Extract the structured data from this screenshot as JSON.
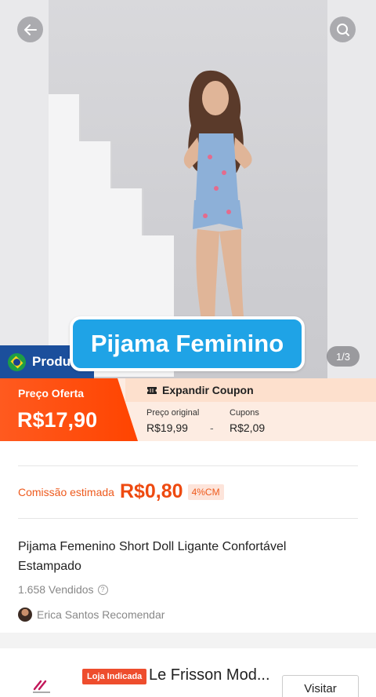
{
  "hero": {
    "image_counter": "1/3",
    "origin_tag": "Produ",
    "title_overlay": "Pijama Feminino"
  },
  "price": {
    "offer_label": "Preço Oferta",
    "offer_value": "R$17,90",
    "coupon_title": "Expandir Coupon",
    "original_label": "Preço original",
    "original_value": "R$19,99",
    "minus": "-",
    "coupons_label": "Cupons",
    "coupons_value": "R$2,09"
  },
  "commission": {
    "label": "Comissão estimada",
    "value": "R$0,80",
    "rate": "4%CM"
  },
  "product": {
    "title": "Pijama Femenino Short Doll Ligante Confortável Estampado",
    "sold": "1.658 Vendidos",
    "recommender": "Erica Santos Recomendar"
  },
  "store": {
    "badge": "Loja Indicada",
    "name": "Le Frisson Mod...",
    "visit_label": "Visitar"
  },
  "colors": {
    "accent": "#ff4400",
    "bubble": "#1fa3e6",
    "origin_tag": "#1b4f9c"
  }
}
